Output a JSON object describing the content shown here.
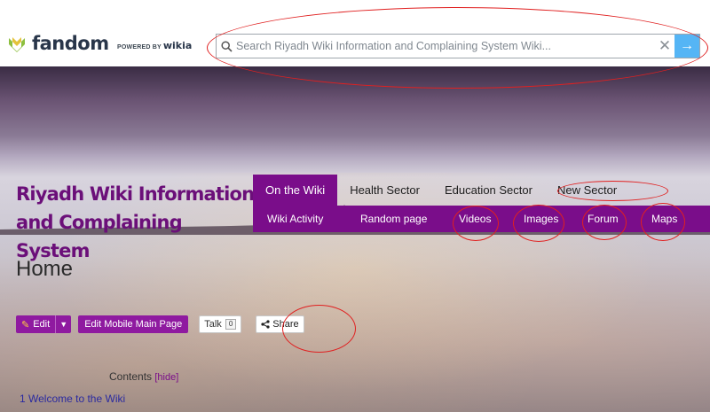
{
  "topbar": {
    "logo_text": "fandom",
    "powered_prefix": "POWERED BY",
    "powered_brand": "wikia",
    "search": {
      "placeholder": "Search Riyadh Wiki Information and Complaining System Wiki...",
      "value": ""
    },
    "clear_symbol": "✕",
    "go_symbol": "→"
  },
  "wiki": {
    "title_line1": "Riyadh Wiki Information",
    "title_line2": "and Complaining System"
  },
  "nav": {
    "tabs": [
      {
        "label": "On the Wiki",
        "active": true
      },
      {
        "label": "Health Sector",
        "active": false
      },
      {
        "label": "Education Sector",
        "active": false
      },
      {
        "label": "New Sector",
        "active": false
      }
    ],
    "sub_items": [
      "Wiki Activity",
      "Random page",
      "Videos",
      "Images",
      "Forum",
      "Maps"
    ]
  },
  "page": {
    "title": "Home"
  },
  "actions": {
    "edit_label": "Edit",
    "edit_mobile_label": "Edit Mobile Main Page",
    "talk_label": "Talk",
    "talk_count": "0",
    "share_label": "Share"
  },
  "toc": {
    "heading": "Contents",
    "toggle": "[hide]",
    "items": [
      "1 Welcome to the Wiki"
    ]
  },
  "colors": {
    "accent": "#7a0d8a",
    "search_button": "#55b5f5",
    "annotation": "#e02020"
  }
}
